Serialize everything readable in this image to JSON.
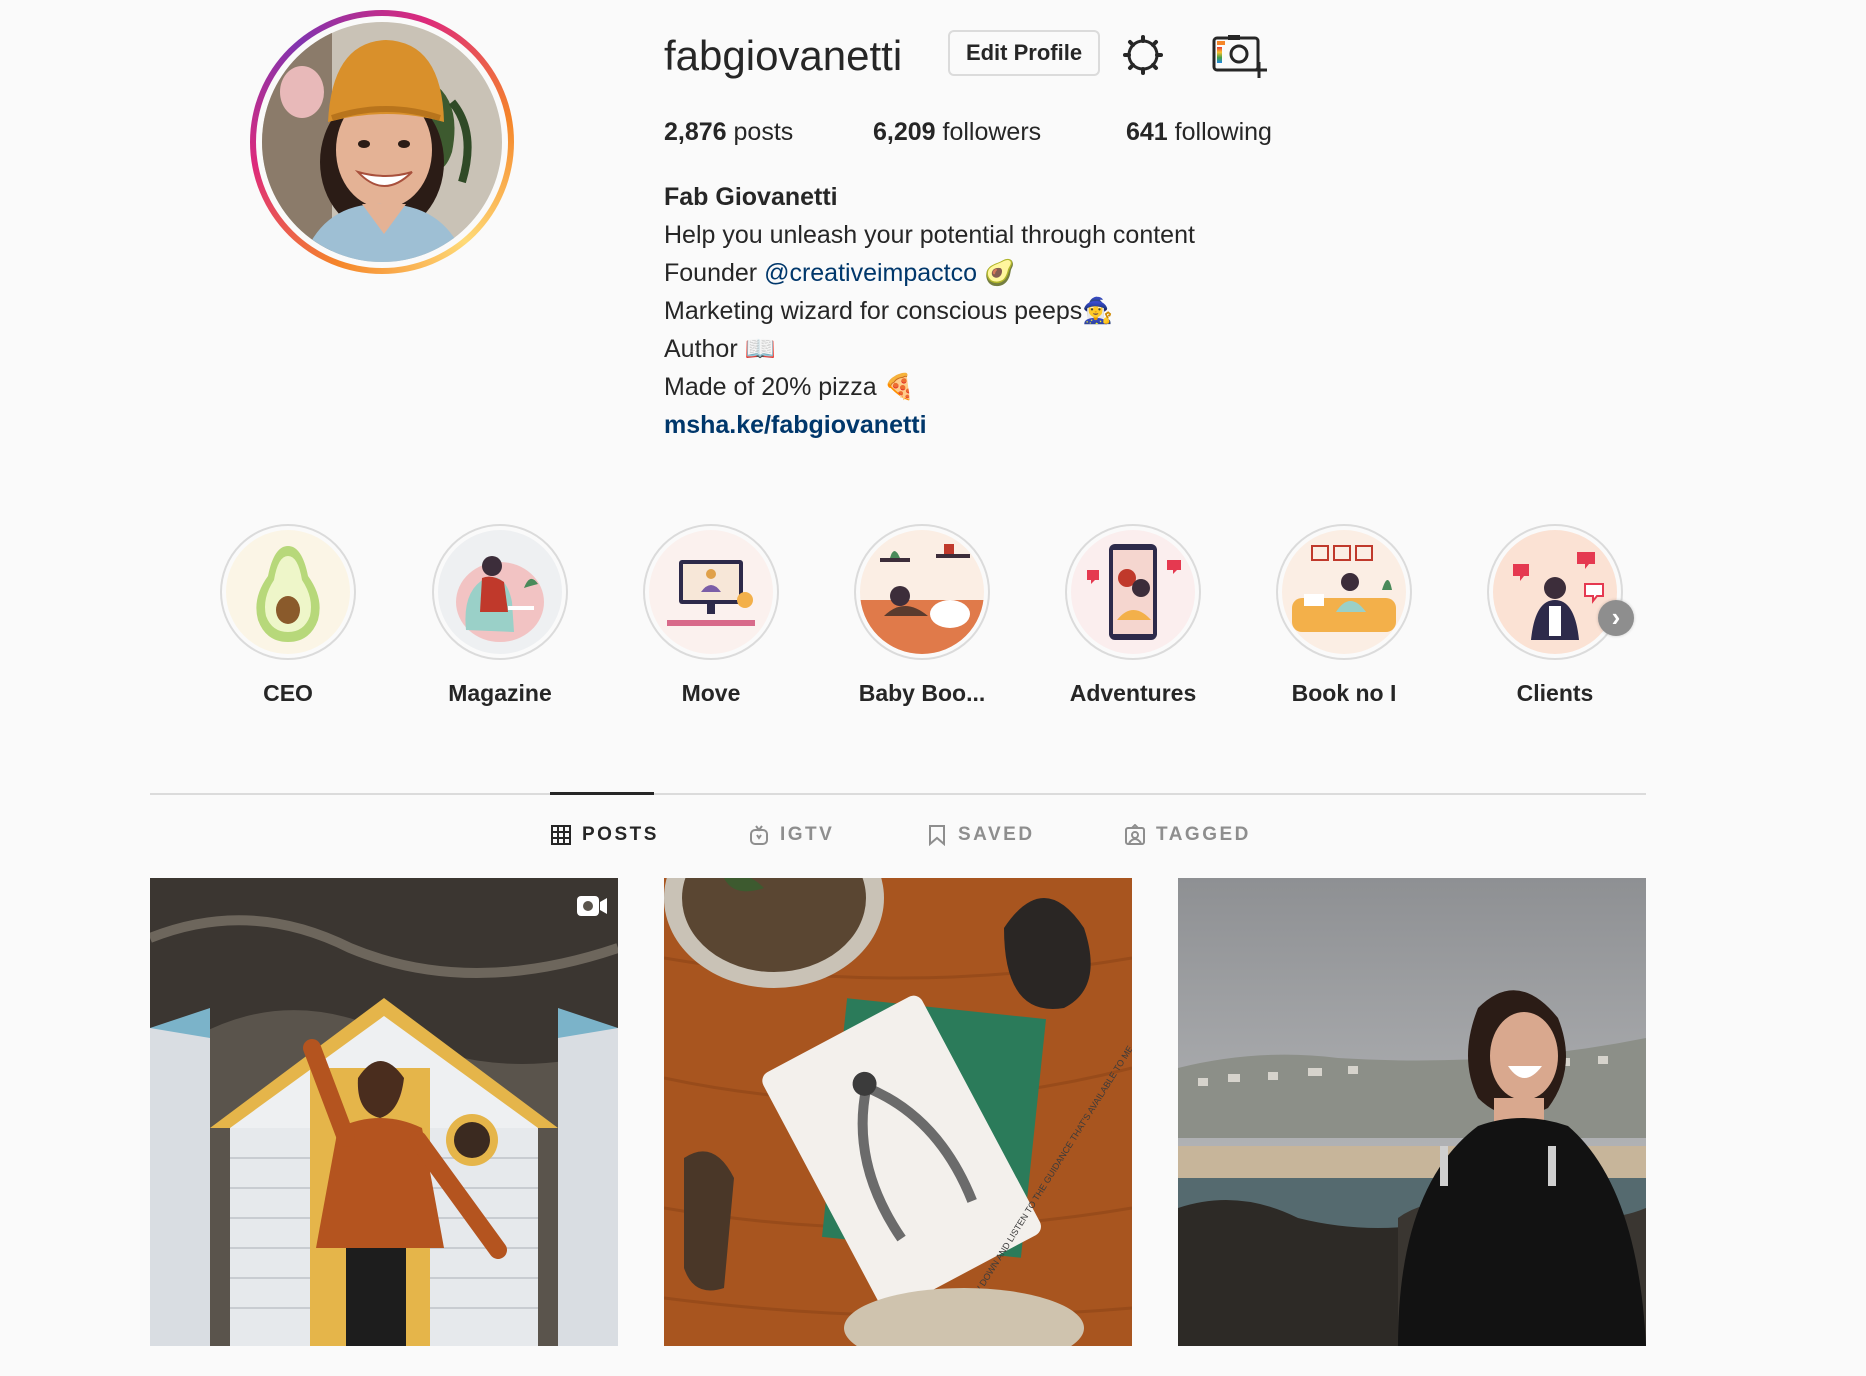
{
  "profile": {
    "username": "fabgiovanetti",
    "edit_button": "Edit Profile",
    "stats": {
      "posts_count": "2,876",
      "posts_label": " posts",
      "followers_count": "6,209",
      "followers_label": " followers",
      "following_count": "641",
      "following_label": " following"
    },
    "bio": {
      "full_name": "Fab Giovanetti",
      "line1": "Help you unleash your potential through content",
      "line2_prefix": "Founder ",
      "line2_mention": "@creativeimpactco",
      "line2_emoji": " 🥑",
      "line3": "Marketing wizard for conscious peeps🧙‍♀️",
      "line4": "Author 📖",
      "line5": "Made of 20% pizza 🍕",
      "website": "msha.ke/fabgiovanetti"
    }
  },
  "highlights": [
    {
      "label": "CEO",
      "icon": "avocado-illustration"
    },
    {
      "label": "Magazine",
      "icon": "reading-chair-illustration"
    },
    {
      "label": "Move",
      "icon": "yoga-screen-illustration"
    },
    {
      "label": "Baby Boo...",
      "icon": "couch-lounge-illustration"
    },
    {
      "label": "Adventures",
      "icon": "phone-selfie-illustration"
    },
    {
      "label": "Book no I",
      "icon": "sofa-reading-illustration"
    },
    {
      "label": "Clients",
      "icon": "social-likes-illustration"
    }
  ],
  "tabs": [
    {
      "label": "POSTS",
      "icon": "grid-icon",
      "active": true
    },
    {
      "label": "IGTV",
      "icon": "igtv-icon",
      "active": false
    },
    {
      "label": "SAVED",
      "icon": "bookmark-icon",
      "active": false
    },
    {
      "label": "TAGGED",
      "icon": "tagged-user-icon",
      "active": false
    }
  ],
  "posts": [
    {
      "type": "video",
      "icon": "video-icon",
      "subject": "woman-beach-hut"
    },
    {
      "type": "image",
      "subject": "oracle-cards-table",
      "card_text": "I SLOW DOWN AND LISTEN TO THE GUIDANCE THAT'S AVAILABLE TO ME"
    },
    {
      "type": "image",
      "subject": "woman-laughing-coast"
    }
  ],
  "colors": {
    "background": "#fafafa",
    "text": "#262626",
    "muted": "#8e8e8e",
    "link": "#00376b",
    "border": "#dbdbdb"
  }
}
